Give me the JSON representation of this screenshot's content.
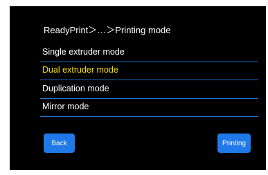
{
  "header": {
    "breadcrumb": "ReadyPrint＞…＞Printing mode"
  },
  "menu": {
    "items": [
      {
        "label": "Single extruder mode",
        "selected": false
      },
      {
        "label": "Dual extruder mode",
        "selected": true
      },
      {
        "label": "Duplication mode",
        "selected": false
      },
      {
        "label": "Mirror mode",
        "selected": false
      }
    ]
  },
  "buttons": {
    "back_label": "Back",
    "printing_label": "Printing"
  },
  "colors": {
    "background": "#000000",
    "text": "#ffffff",
    "selected_text": "#f3e000",
    "divider": "#1f78d6",
    "button": "#2079e8"
  }
}
